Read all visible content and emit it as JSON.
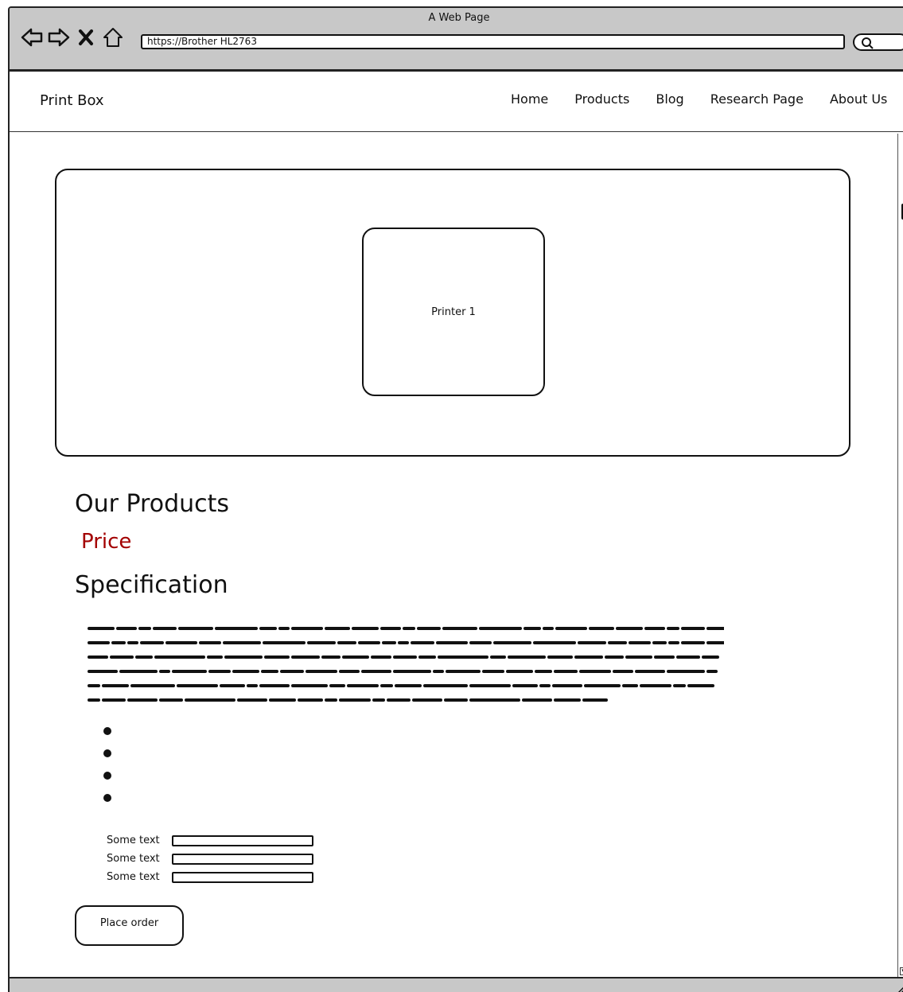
{
  "window": {
    "title": "A Web Page"
  },
  "browser": {
    "url": "https://Brother HL2763",
    "nav_icons": [
      "back-arrow-icon",
      "forward-arrow-icon",
      "close-icon",
      "home-icon"
    ],
    "search_icon": "search-icon"
  },
  "header": {
    "brand": "Print Box",
    "menu": [
      "Home",
      "Products",
      "Blog",
      "Research Page",
      "About Us"
    ]
  },
  "hero": {
    "card_label": "Printer 1"
  },
  "content": {
    "heading_products": "Our Products",
    "heading_price": "Price",
    "heading_spec": "Specification",
    "bullet_count": 4
  },
  "form": {
    "fields": [
      {
        "label": "Some text",
        "value": ""
      },
      {
        "label": "Some text",
        "value": ""
      },
      {
        "label": "Some text",
        "value": ""
      }
    ],
    "submit_label": "Place order"
  },
  "colors": {
    "price": "#a30000",
    "chrome": "#c8c8c8"
  }
}
